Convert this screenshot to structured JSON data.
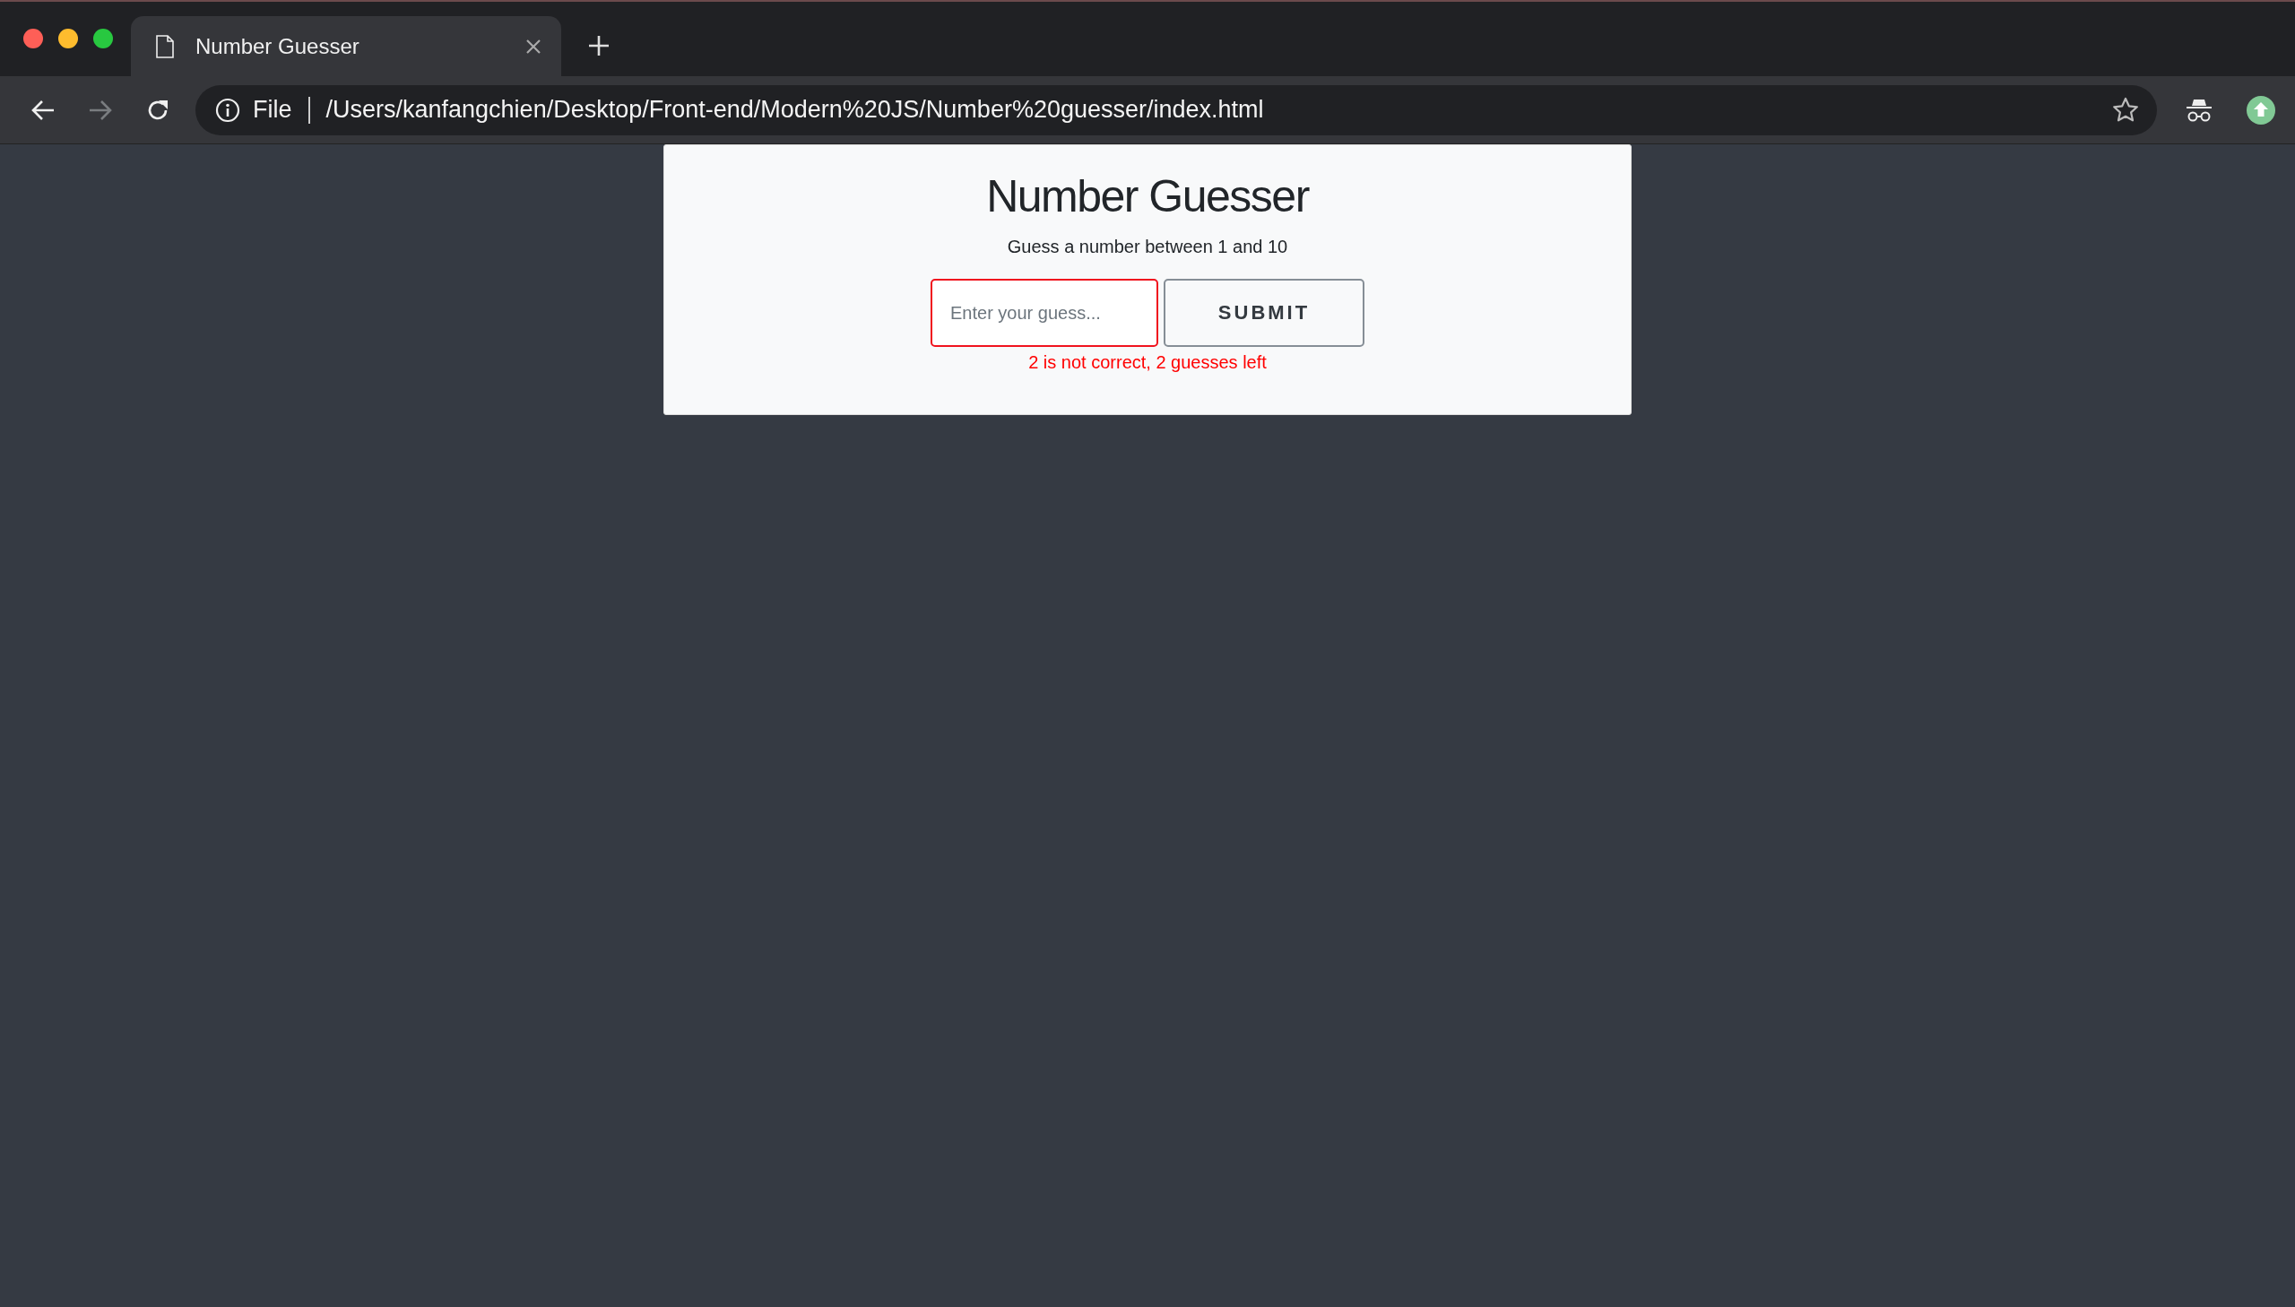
{
  "window": {
    "tabs": [
      {
        "title": "Number Guesser",
        "selected": true
      }
    ],
    "nav": [
      {
        "kind": "back",
        "disabled": false
      },
      {
        "kind": "forward",
        "disabled": true
      },
      {
        "kind": "reload",
        "disabled": false
      }
    ],
    "address_bar": {
      "scheme": "File",
      "url": "/Users/kanfangchien/Desktop/Front-end/Modern%20JS/Number%20guesser/index.html"
    }
  },
  "page": {
    "title": "Number Guesser",
    "subtitle": "Guess a number between 1 and 10",
    "guess_field": {
      "placeholder": "Enter your guess...",
      "invalid": true
    },
    "submit_button": "SUBMIT",
    "message": {
      "text": "2 is not correct, 2 guesses left",
      "kind": "error"
    }
  }
}
